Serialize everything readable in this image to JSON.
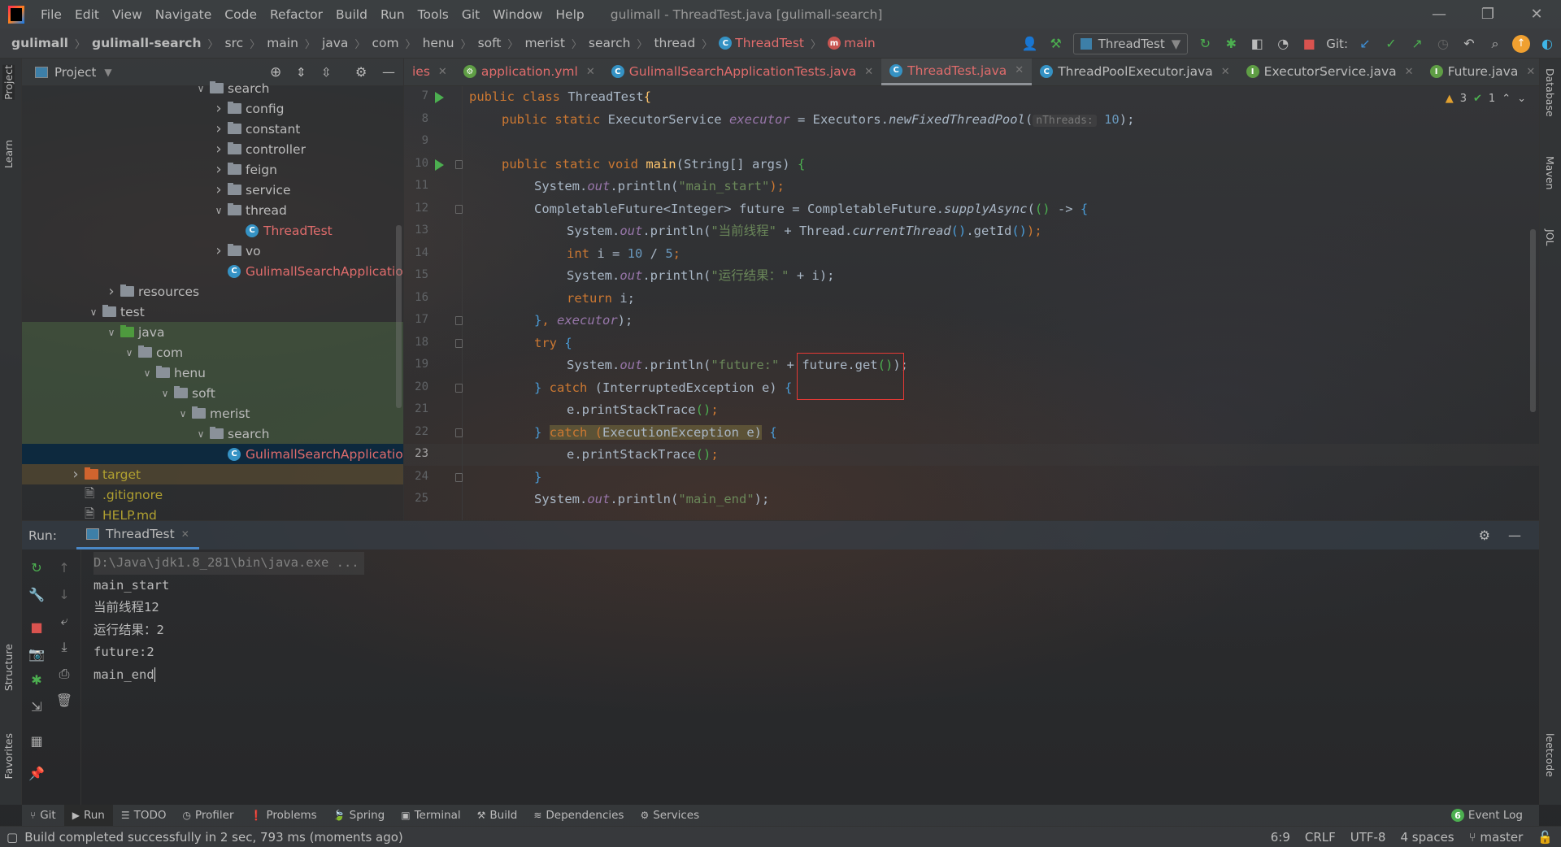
{
  "window": {
    "title": "gulimall - ThreadTest.java [gulimall-search]"
  },
  "menu": [
    "File",
    "Edit",
    "View",
    "Navigate",
    "Code",
    "Refactor",
    "Build",
    "Run",
    "Tools",
    "Git",
    "Window",
    "Help"
  ],
  "breadcrumb": [
    "gulimall",
    "gulimall-search",
    "src",
    "main",
    "java",
    "com",
    "henu",
    "soft",
    "merist",
    "search",
    "thread",
    "ThreadTest",
    "main"
  ],
  "toolbar": {
    "run_config": "ThreadTest",
    "git_label": "Git:"
  },
  "project": {
    "title": "Project",
    "tree": [
      {
        "label": "search",
        "level": 7,
        "exp": "open",
        "type": "folder"
      },
      {
        "label": "config",
        "level": 8,
        "exp": "closed",
        "type": "folder"
      },
      {
        "label": "constant",
        "level": 8,
        "exp": "closed",
        "type": "folder"
      },
      {
        "label": "controller",
        "level": 8,
        "exp": "closed",
        "type": "folder"
      },
      {
        "label": "feign",
        "level": 8,
        "exp": "closed",
        "type": "folder"
      },
      {
        "label": "service",
        "level": 8,
        "exp": "closed",
        "type": "folder"
      },
      {
        "label": "thread",
        "level": 8,
        "exp": "open",
        "type": "folder"
      },
      {
        "label": "ThreadTest",
        "level": 9,
        "exp": "",
        "type": "class",
        "color": "red"
      },
      {
        "label": "vo",
        "level": 8,
        "exp": "closed",
        "type": "folder"
      },
      {
        "label": "GulimallSearchApplication",
        "level": 8,
        "exp": "",
        "type": "class",
        "color": "red"
      },
      {
        "label": "resources",
        "level": 2,
        "exp": "closed",
        "type": "folder"
      },
      {
        "label": "test",
        "level": 1,
        "exp": "open",
        "type": "folder"
      },
      {
        "label": "java",
        "level": 2,
        "exp": "open",
        "type": "folder-green",
        "bg": "green"
      },
      {
        "label": "com",
        "level": 3,
        "exp": "open",
        "type": "folder",
        "bg": "green"
      },
      {
        "label": "henu",
        "level": 4,
        "exp": "open",
        "type": "folder",
        "bg": "green"
      },
      {
        "label": "soft",
        "level": 5,
        "exp": "open",
        "type": "folder",
        "bg": "green"
      },
      {
        "label": "merist",
        "level": 6,
        "exp": "open",
        "type": "folder",
        "bg": "green"
      },
      {
        "label": "search",
        "level": 7,
        "exp": "open",
        "type": "folder",
        "bg": "green"
      },
      {
        "label": "GulimallSearchApplication",
        "level": 8,
        "exp": "",
        "type": "class",
        "color": "red",
        "bg": "selected"
      },
      {
        "label": "target",
        "level": 0,
        "exp": "closed",
        "type": "folder-orange",
        "color": "olive",
        "bg": "orange"
      },
      {
        "label": ".gitignore",
        "level": 0,
        "exp": "",
        "type": "file",
        "color": "olive"
      },
      {
        "label": "HELP.md",
        "level": 0,
        "exp": "",
        "type": "file",
        "color": "olive"
      }
    ]
  },
  "editor": {
    "tabs": [
      {
        "label": "ies",
        "color": "red",
        "icon": ""
      },
      {
        "label": "application.yml",
        "color": "red",
        "icon": "yml"
      },
      {
        "label": "GulimallSearchApplicationTests.java",
        "color": "red",
        "icon": "class"
      },
      {
        "label": "ThreadTest.java",
        "color": "red",
        "icon": "class",
        "active": true
      },
      {
        "label": "ThreadPoolExecutor.java",
        "color": "",
        "icon": "class"
      },
      {
        "label": "ExecutorService.java",
        "color": "",
        "icon": "interface"
      },
      {
        "label": "Future.java",
        "color": "",
        "icon": "interface"
      }
    ],
    "inspections": {
      "warnings": "3",
      "ok": "1"
    },
    "current_line": 23,
    "lines": [
      {
        "n": 7,
        "run": true,
        "ind": 0,
        "t": [
          [
            "public class ",
            "kw"
          ],
          [
            "ThreadTest",
            ""
          ],
          [
            "{",
            "mth"
          ]
        ]
      },
      {
        "n": 8,
        "ind": 1,
        "t": [
          [
            "public static ",
            "kw"
          ],
          [
            "ExecutorService ",
            ""
          ],
          [
            "executor",
            "fld"
          ],
          [
            " = Executors.",
            ""
          ],
          [
            "newFixedThreadPool",
            "ital"
          ],
          [
            "(",
            ""
          ],
          [
            "nThreads:",
            "hint"
          ],
          [
            " ",
            ""
          ],
          [
            "10",
            "num"
          ],
          [
            ");",
            ""
          ]
        ]
      },
      {
        "n": 9,
        "ind": 0,
        "t": []
      },
      {
        "n": 10,
        "run": true,
        "fold": true,
        "ind": 1,
        "t": [
          [
            "public static void ",
            "kw"
          ],
          [
            "main",
            "mth"
          ],
          [
            "(String[] args) ",
            ""
          ],
          [
            "{",
            "brg"
          ]
        ]
      },
      {
        "n": 11,
        "ind": 2,
        "t": [
          [
            "System.",
            ""
          ],
          [
            "out",
            "fld"
          ],
          [
            ".println(",
            ""
          ],
          [
            "\"main_start\"",
            "str"
          ],
          [
            ");",
            "kw"
          ]
        ]
      },
      {
        "n": 12,
        "fold": true,
        "ind": 2,
        "t": [
          [
            "CompletableFuture<Integer> future = CompletableFuture.",
            ""
          ],
          [
            "supplyAsync",
            "ital"
          ],
          [
            "(",
            ""
          ],
          [
            "()",
            "brg"
          ],
          [
            " -> ",
            ""
          ],
          [
            "{",
            "br"
          ]
        ]
      },
      {
        "n": 13,
        "ind": 3,
        "t": [
          [
            "System.",
            ""
          ],
          [
            "out",
            "fld"
          ],
          [
            ".println(",
            ""
          ],
          [
            "\"当前线程\"",
            "str"
          ],
          [
            " + Thread.",
            ""
          ],
          [
            "currentThread",
            "ital"
          ],
          [
            "()",
            "br"
          ],
          [
            ".getId",
            ""
          ],
          [
            "()",
            "br"
          ],
          [
            ");",
            "kw"
          ]
        ]
      },
      {
        "n": 14,
        "ind": 3,
        "t": [
          [
            "int ",
            "kw"
          ],
          [
            "i = ",
            ""
          ],
          [
            "10",
            "num"
          ],
          [
            " / ",
            ""
          ],
          [
            "5",
            "num"
          ],
          [
            ";",
            "kw"
          ]
        ]
      },
      {
        "n": 15,
        "ind": 3,
        "t": [
          [
            "System.",
            ""
          ],
          [
            "out",
            "fld"
          ],
          [
            ".println(",
            ""
          ],
          [
            "\"运行结果：\"",
            "str"
          ],
          [
            " + i);",
            ""
          ]
        ]
      },
      {
        "n": 16,
        "ind": 3,
        "t": [
          [
            "return ",
            "kw"
          ],
          [
            "i;",
            ""
          ]
        ]
      },
      {
        "n": 17,
        "fold": true,
        "ind": 2,
        "t": [
          [
            "}",
            "br"
          ],
          [
            ", ",
            "kw"
          ],
          [
            "executor",
            "fld"
          ],
          [
            ");",
            ""
          ]
        ]
      },
      {
        "n": 18,
        "fold": true,
        "ind": 2,
        "t": [
          [
            "try ",
            "kw"
          ],
          [
            "{",
            "br"
          ]
        ]
      },
      {
        "n": 19,
        "ind": 3,
        "t": [
          [
            "System.",
            ""
          ],
          [
            "out",
            "fld"
          ],
          [
            ".println(",
            ""
          ],
          [
            "\"future:\"",
            "str"
          ],
          [
            " + future.get",
            ""
          ],
          [
            "()",
            "brg"
          ],
          [
            ");",
            ""
          ]
        ]
      },
      {
        "n": 20,
        "fold": true,
        "ind": 2,
        "t": [
          [
            "}",
            "br"
          ],
          [
            " catch ",
            "kw"
          ],
          [
            "(InterruptedException e) ",
            ""
          ],
          [
            "{",
            "br"
          ]
        ]
      },
      {
        "n": 21,
        "ind": 3,
        "t": [
          [
            "e.printStackTrace",
            ""
          ],
          [
            "()",
            "brg"
          ],
          [
            ";",
            "kw"
          ]
        ]
      },
      {
        "n": 22,
        "fold": true,
        "ind": 2,
        "t": [
          [
            "}",
            "br"
          ],
          [
            " ",
            ""
          ],
          [
            "catch (",
            "kw hl"
          ],
          [
            "ExecutionException e)",
            "hl"
          ],
          [
            " ",
            ""
          ],
          [
            "{",
            "br"
          ]
        ]
      },
      {
        "n": 23,
        "ind": 3,
        "t": [
          [
            "e.printStackTrace",
            ""
          ],
          [
            "()",
            "brg"
          ],
          [
            ";",
            "kw"
          ]
        ]
      },
      {
        "n": 24,
        "fold": true,
        "ind": 2,
        "t": [
          [
            "}",
            "br"
          ]
        ]
      },
      {
        "n": 25,
        "ind": 2,
        "t": [
          [
            "System.",
            ""
          ],
          [
            "out",
            "fld"
          ],
          [
            ".println(",
            ""
          ],
          [
            "\"main_end\"",
            "str"
          ],
          [
            ");",
            ""
          ]
        ]
      }
    ]
  },
  "run": {
    "label": "Run:",
    "tab": "ThreadTest",
    "output": [
      "D:\\Java\\jdk1.8_281\\bin\\java.exe ...",
      "main_start",
      "当前线程12",
      "运行结果：2",
      "future:2",
      "main_end"
    ]
  },
  "tool_windows": [
    "Git",
    "Run",
    "TODO",
    "Profiler",
    "Problems",
    "Spring",
    "Terminal",
    "Build",
    "Dependencies",
    "Services"
  ],
  "event_log": {
    "label": "Event Log",
    "count": "6"
  },
  "left_strip": [
    "Project",
    "Learn",
    "Structure",
    "Favorites"
  ],
  "right_strip": [
    "Database",
    "Maven",
    "JOL",
    "leetcode"
  ],
  "status": {
    "message": "Build completed successfully in 2 sec, 793 ms (moments ago)",
    "position": "6:9",
    "line_sep": "CRLF",
    "encoding": "UTF-8",
    "indent": "4 spaces",
    "branch": "master"
  },
  "colors": {
    "keyword": "#cc7832",
    "string": "#6a8759",
    "number": "#6897bb",
    "field": "#9876aa",
    "highlight_box": "#e53935",
    "accent": "#4a88c7"
  }
}
